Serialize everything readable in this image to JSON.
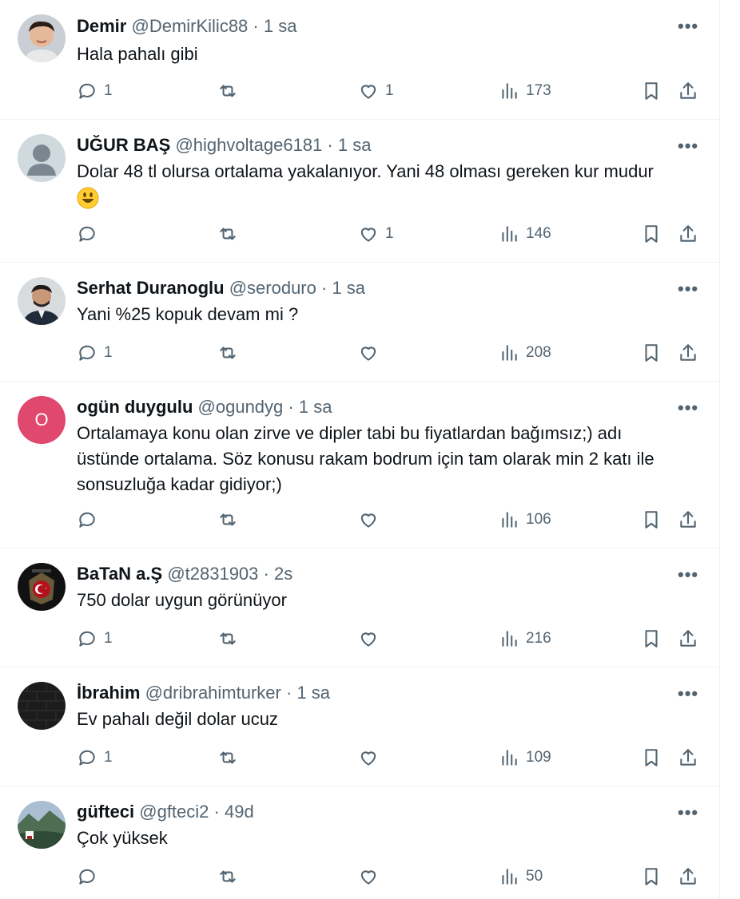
{
  "tweets": [
    {
      "name": "Demir",
      "handle": "@DemirKilic88",
      "time": "1 sa",
      "lines": [
        "Hala pahalı gibi"
      ],
      "replies": "1",
      "retweets": "",
      "likes": "1",
      "views": "173",
      "avatar": "person1"
    },
    {
      "name": "UĞUR BAŞ",
      "handle": "@highvoltage6181",
      "time": "1 sa",
      "lines": [
        "Dolar 48 tl olursa ortalama yakalanıyor. Yani 48 olması gereken kur mudur"
      ],
      "replies": "",
      "retweets": "",
      "likes": "1",
      "views": "146",
      "avatar": "default",
      "emoji": "smiley-face"
    },
    {
      "name": "Serhat Duranoglu",
      "handle": "@seroduro",
      "time": "1 sa",
      "lines": [
        "Yani %25 kopuk devam mi ?"
      ],
      "replies": "1",
      "retweets": "",
      "likes": "",
      "views": "208",
      "avatar": "person2"
    },
    {
      "name": "ogün duygulu",
      "handle": "@ogundyg",
      "time": "1 sa",
      "lines": [
        "Ortalamaya konu olan zirve ve dipler tabi bu fiyatlardan bağımsız;) adı",
        "üstünde ortalama. Söz konusu rakam bodrum için tam olarak min 2 katı ile",
        "sonsuzluğa kadar gidiyor;)"
      ],
      "replies": "",
      "retweets": "",
      "likes": "",
      "views": "106",
      "avatar": "letter",
      "avatar_letter": "O",
      "avatar_color": "#e0486e"
    },
    {
      "name": "BaTaN a.Ş",
      "handle": "@t2831903",
      "time": "2s",
      "lines": [
        "750 dolar uygun görünüyor"
      ],
      "replies": "1",
      "retweets": "",
      "likes": "",
      "views": "216",
      "avatar": "emblem"
    },
    {
      "name": "İbrahim",
      "handle": "@dribrahimturker",
      "time": "1 sa",
      "lines": [
        "Ev pahalı değil dolar ucuz"
      ],
      "replies": "1",
      "retweets": "",
      "likes": "",
      "views": "109",
      "avatar": "dark"
    },
    {
      "name": "güfteci",
      "handle": "@gfteci2",
      "time": "49d",
      "lines": [
        "Çok yüksek"
      ],
      "replies": "",
      "retweets": "",
      "likes": "",
      "views": "50",
      "avatar": "landscape"
    }
  ],
  "icons": {
    "reply": "reply-icon",
    "retweet": "retweet-icon",
    "like": "heart-icon",
    "views": "views-chart-icon",
    "bookmark": "bookmark-icon",
    "share": "share-icon",
    "more": "more-icon"
  },
  "colors": {
    "text": "#0f1419",
    "muted": "#536471",
    "divider": "#eff3f4"
  },
  "more_label": "•••",
  "separator": "·"
}
